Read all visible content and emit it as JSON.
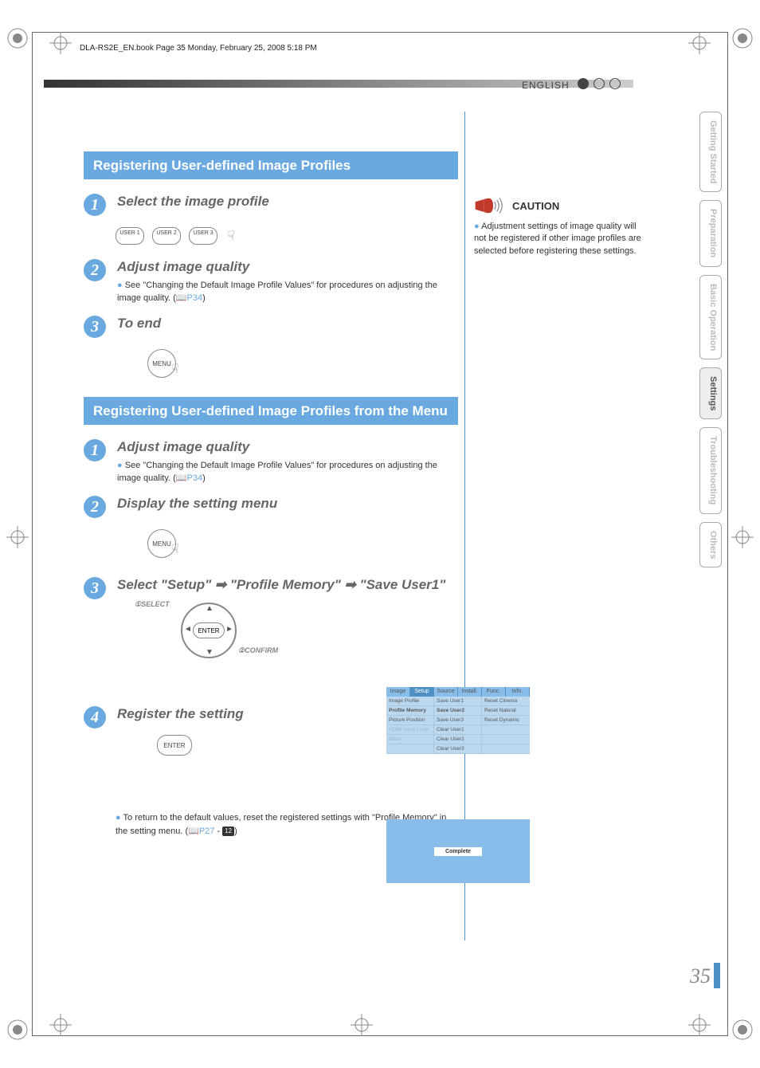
{
  "header_line": "DLA-RS2E_EN.book  Page 35  Monday, February 25, 2008  5:18 PM",
  "language_label": "ENGLISH",
  "page_number": "35",
  "side_tabs": [
    {
      "label": "Getting Started",
      "active": false
    },
    {
      "label": "Preparation",
      "active": false
    },
    {
      "label": "Basic Operation",
      "active": false
    },
    {
      "label": "Settings",
      "active": true
    },
    {
      "label": "Troubleshooting",
      "active": false
    },
    {
      "label": "Others",
      "active": false
    }
  ],
  "sectionA": {
    "title": "Registering User-defined Image Profiles",
    "steps": [
      {
        "num": "1",
        "title": "Select the image profile"
      },
      {
        "num": "2",
        "title": "Adjust image quality",
        "note": "See \"Changing the Default Image Profile Values\" for procedures on adjusting the image quality. (",
        "ref": "P34",
        "note_after": ")"
      },
      {
        "num": "3",
        "title": "To end"
      }
    ],
    "user_buttons": [
      "USER 1",
      "USER 2",
      "USER 3"
    ],
    "menu_button": "MENU"
  },
  "sectionB": {
    "title": "Registering User-defined Image Profiles from the Menu",
    "steps": [
      {
        "num": "1",
        "title": "Adjust image quality",
        "note": "See \"Changing the Default Image Profile Values\" for procedures on adjusting the image quality. (",
        "ref": "P34",
        "note_after": ")"
      },
      {
        "num": "2",
        "title": "Display the setting menu"
      },
      {
        "num": "3",
        "title_a": "Select \"Setup\" ",
        "title_b": " \"Profile Memory\" ",
        "title_c": " \"Save User1\""
      },
      {
        "num": "4",
        "title": "Register the setting"
      }
    ],
    "menu_button": "MENU",
    "enter_button": "ENTER",
    "dpad_labels": {
      "select": "SELECT",
      "confirm": "CONFIRM",
      "circ1": "①",
      "circ2": "②"
    },
    "footer_note_a": "To return to the default values, reset the registered settings with \"Profile Memory\" in the setting menu. (",
    "footer_ref": "P27",
    "footer_badge": "12",
    "footer_note_b": ")"
  },
  "menu_ui": {
    "tabs": [
      "Image",
      "Setup",
      "Source",
      "Install.",
      "Func.",
      "Info."
    ],
    "rows": [
      {
        "c1": "Image Profile",
        "c2": "Save User1",
        "c3": "Reset Cinema",
        "hl": false
      },
      {
        "c1": "Profile Memory",
        "c2": "Save User2",
        "c3": "Reset Natural",
        "hl": true
      },
      {
        "c1": "Picture Position",
        "c2": "Save User3",
        "c3": "Reset Dynamic",
        "hl": false
      },
      {
        "c1": "HDMI Input Level",
        "c2": "Clear User1",
        "c3": "",
        "dim": true
      },
      {
        "c1": "Mask",
        "c2": "Clear User2",
        "c3": "",
        "dim": true
      },
      {
        "c1": "",
        "c2": "Clear User3",
        "c3": ""
      }
    ]
  },
  "complete_label": "Complete",
  "caution": {
    "title": "CAUTION",
    "text": "Adjustment settings of image quality will not be registered if other image profiles are selected before registering these settings."
  }
}
